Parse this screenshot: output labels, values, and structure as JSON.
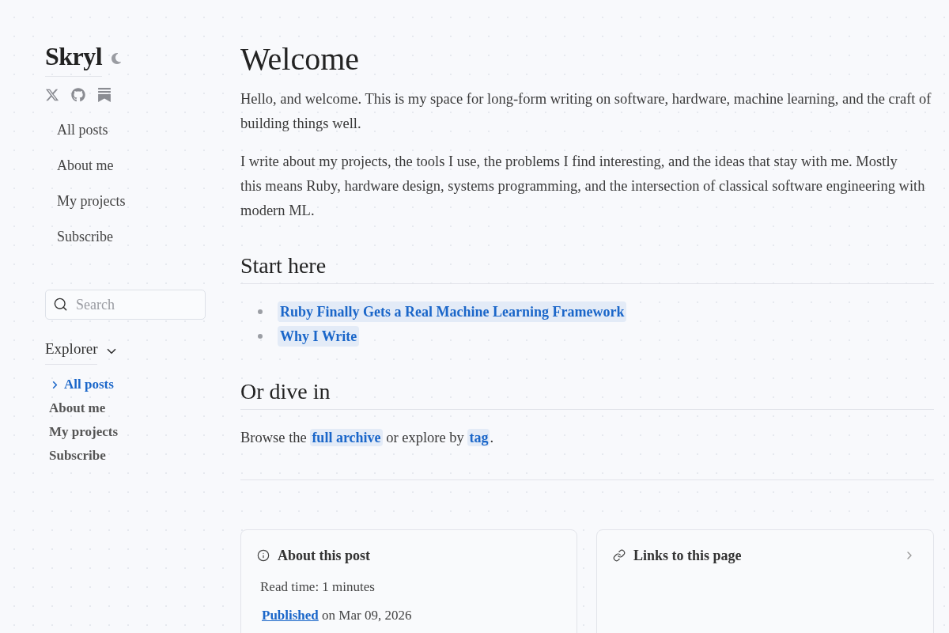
{
  "sidebar": {
    "title": "Skryl",
    "nav": [
      {
        "label": "All posts"
      },
      {
        "label": "About me"
      },
      {
        "label": "My projects"
      },
      {
        "label": "Subscribe"
      }
    ],
    "search": {
      "placeholder": "Search"
    },
    "explorer": {
      "title": "Explorer",
      "expanded": true,
      "items": [
        {
          "label": "All posts",
          "selected": true
        },
        {
          "label": "About me",
          "selected": false
        },
        {
          "label": "My projects",
          "selected": false
        },
        {
          "label": "Subscribe",
          "selected": false
        }
      ]
    }
  },
  "article": {
    "title": "Welcome",
    "paragraphs": [
      "Hello, and welcome. This is my space for long-form writing on software, hardware, machine learning, and the craft of building things well.",
      "I write about my projects, the tools I use, the problems I find interesting, and the ideas that stay with me. Mostly\nthis means Ruby, hardware design, systems programming, and the intersection of classical software engineering with modern ML."
    ],
    "sections": [
      {
        "kind": "list",
        "heading": "Start here",
        "links": [
          "Ruby Finally Gets a Real Machine Learning Framework",
          "Why I Write"
        ]
      },
      {
        "kind": "text",
        "heading": "Or dive in",
        "segments": [
          {
            "kind": "text",
            "text": "Browse the "
          },
          {
            "kind": "link",
            "text": "full archive"
          },
          {
            "kind": "text",
            "text": " or explore by "
          },
          {
            "kind": "link",
            "text": "tag"
          },
          {
            "kind": "text",
            "text": "."
          }
        ]
      }
    ]
  },
  "cards": [
    {
      "kind": "info",
      "title": "About this post",
      "read_time": "Read time: 1 minutes",
      "published": {
        "link": "Published",
        "text": "on Mar 09, 2026"
      }
    },
    {
      "kind": "backlinks",
      "title": "Links to this page",
      "expanded": false
    }
  ]
}
